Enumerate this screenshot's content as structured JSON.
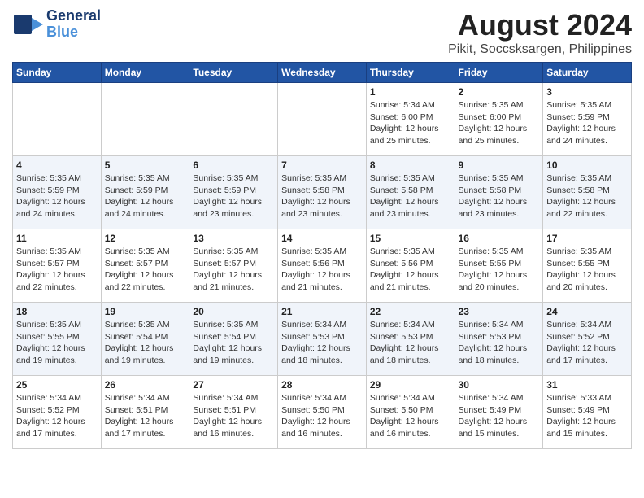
{
  "logo": {
    "line1": "General",
    "line2": "Blue"
  },
  "title": "August 2024",
  "subtitle": "Pikit, Soccsksargen, Philippines",
  "days_of_week": [
    "Sunday",
    "Monday",
    "Tuesday",
    "Wednesday",
    "Thursday",
    "Friday",
    "Saturday"
  ],
  "weeks": [
    [
      {
        "day": "",
        "info": ""
      },
      {
        "day": "",
        "info": ""
      },
      {
        "day": "",
        "info": ""
      },
      {
        "day": "",
        "info": ""
      },
      {
        "day": "1",
        "info": "Sunrise: 5:34 AM\nSunset: 6:00 PM\nDaylight: 12 hours\nand 25 minutes."
      },
      {
        "day": "2",
        "info": "Sunrise: 5:35 AM\nSunset: 6:00 PM\nDaylight: 12 hours\nand 25 minutes."
      },
      {
        "day": "3",
        "info": "Sunrise: 5:35 AM\nSunset: 5:59 PM\nDaylight: 12 hours\nand 24 minutes."
      }
    ],
    [
      {
        "day": "4",
        "info": "Sunrise: 5:35 AM\nSunset: 5:59 PM\nDaylight: 12 hours\nand 24 minutes."
      },
      {
        "day": "5",
        "info": "Sunrise: 5:35 AM\nSunset: 5:59 PM\nDaylight: 12 hours\nand 24 minutes."
      },
      {
        "day": "6",
        "info": "Sunrise: 5:35 AM\nSunset: 5:59 PM\nDaylight: 12 hours\nand 23 minutes."
      },
      {
        "day": "7",
        "info": "Sunrise: 5:35 AM\nSunset: 5:58 PM\nDaylight: 12 hours\nand 23 minutes."
      },
      {
        "day": "8",
        "info": "Sunrise: 5:35 AM\nSunset: 5:58 PM\nDaylight: 12 hours\nand 23 minutes."
      },
      {
        "day": "9",
        "info": "Sunrise: 5:35 AM\nSunset: 5:58 PM\nDaylight: 12 hours\nand 23 minutes."
      },
      {
        "day": "10",
        "info": "Sunrise: 5:35 AM\nSunset: 5:58 PM\nDaylight: 12 hours\nand 22 minutes."
      }
    ],
    [
      {
        "day": "11",
        "info": "Sunrise: 5:35 AM\nSunset: 5:57 PM\nDaylight: 12 hours\nand 22 minutes."
      },
      {
        "day": "12",
        "info": "Sunrise: 5:35 AM\nSunset: 5:57 PM\nDaylight: 12 hours\nand 22 minutes."
      },
      {
        "day": "13",
        "info": "Sunrise: 5:35 AM\nSunset: 5:57 PM\nDaylight: 12 hours\nand 21 minutes."
      },
      {
        "day": "14",
        "info": "Sunrise: 5:35 AM\nSunset: 5:56 PM\nDaylight: 12 hours\nand 21 minutes."
      },
      {
        "day": "15",
        "info": "Sunrise: 5:35 AM\nSunset: 5:56 PM\nDaylight: 12 hours\nand 21 minutes."
      },
      {
        "day": "16",
        "info": "Sunrise: 5:35 AM\nSunset: 5:55 PM\nDaylight: 12 hours\nand 20 minutes."
      },
      {
        "day": "17",
        "info": "Sunrise: 5:35 AM\nSunset: 5:55 PM\nDaylight: 12 hours\nand 20 minutes."
      }
    ],
    [
      {
        "day": "18",
        "info": "Sunrise: 5:35 AM\nSunset: 5:55 PM\nDaylight: 12 hours\nand 19 minutes."
      },
      {
        "day": "19",
        "info": "Sunrise: 5:35 AM\nSunset: 5:54 PM\nDaylight: 12 hours\nand 19 minutes."
      },
      {
        "day": "20",
        "info": "Sunrise: 5:35 AM\nSunset: 5:54 PM\nDaylight: 12 hours\nand 19 minutes."
      },
      {
        "day": "21",
        "info": "Sunrise: 5:34 AM\nSunset: 5:53 PM\nDaylight: 12 hours\nand 18 minutes."
      },
      {
        "day": "22",
        "info": "Sunrise: 5:34 AM\nSunset: 5:53 PM\nDaylight: 12 hours\nand 18 minutes."
      },
      {
        "day": "23",
        "info": "Sunrise: 5:34 AM\nSunset: 5:53 PM\nDaylight: 12 hours\nand 18 minutes."
      },
      {
        "day": "24",
        "info": "Sunrise: 5:34 AM\nSunset: 5:52 PM\nDaylight: 12 hours\nand 17 minutes."
      }
    ],
    [
      {
        "day": "25",
        "info": "Sunrise: 5:34 AM\nSunset: 5:52 PM\nDaylight: 12 hours\nand 17 minutes."
      },
      {
        "day": "26",
        "info": "Sunrise: 5:34 AM\nSunset: 5:51 PM\nDaylight: 12 hours\nand 17 minutes."
      },
      {
        "day": "27",
        "info": "Sunrise: 5:34 AM\nSunset: 5:51 PM\nDaylight: 12 hours\nand 16 minutes."
      },
      {
        "day": "28",
        "info": "Sunrise: 5:34 AM\nSunset: 5:50 PM\nDaylight: 12 hours\nand 16 minutes."
      },
      {
        "day": "29",
        "info": "Sunrise: 5:34 AM\nSunset: 5:50 PM\nDaylight: 12 hours\nand 16 minutes."
      },
      {
        "day": "30",
        "info": "Sunrise: 5:34 AM\nSunset: 5:49 PM\nDaylight: 12 hours\nand 15 minutes."
      },
      {
        "day": "31",
        "info": "Sunrise: 5:33 AM\nSunset: 5:49 PM\nDaylight: 12 hours\nand 15 minutes."
      }
    ]
  ]
}
